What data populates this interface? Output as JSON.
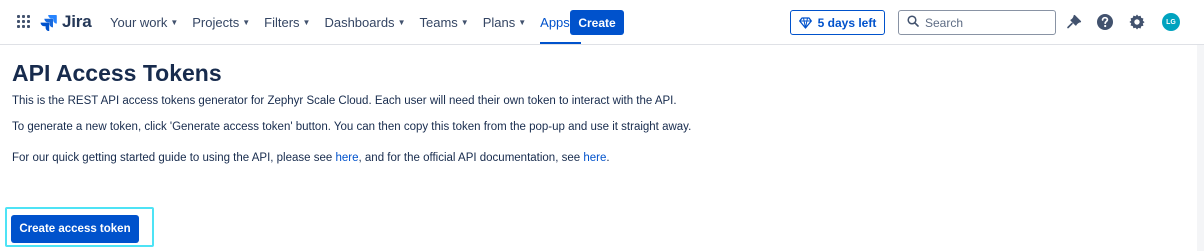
{
  "header": {
    "app_name": "Jira",
    "nav": [
      {
        "label": "Your work",
        "active": false
      },
      {
        "label": "Projects",
        "active": false
      },
      {
        "label": "Filters",
        "active": false
      },
      {
        "label": "Dashboards",
        "active": false
      },
      {
        "label": "Teams",
        "active": false
      },
      {
        "label": "Plans",
        "active": false
      },
      {
        "label": "Apps",
        "active": true
      }
    ],
    "create_label": "Create",
    "trial_label": "5 days left",
    "search_placeholder": "Search",
    "avatar_initials": "LG",
    "icons": [
      "app-switcher-icon",
      "jira-logo-icon",
      "gem-icon",
      "search-icon",
      "notifications-icon",
      "help-icon",
      "settings-icon"
    ]
  },
  "main": {
    "title": "API Access Tokens",
    "intro": "This is the REST API access tokens generator for Zephyr Scale Cloud. Each user will need their own token to interact with the API.",
    "instructions": "To generate a new token, click 'Generate access token' button. You can then copy this token from the pop-up and use it straight away.",
    "guide": {
      "prefix": "For our quick getting started guide to using the API, please see ",
      "link1": "here",
      "middle": ", and for the official API documentation, see ",
      "link2": "here",
      "suffix": "."
    },
    "button_label": "Create access token"
  },
  "colors": {
    "primary": "#0052cc",
    "text": "#172b4d",
    "highlight": "#4ee3f5",
    "avatar": "#00a3bf"
  }
}
